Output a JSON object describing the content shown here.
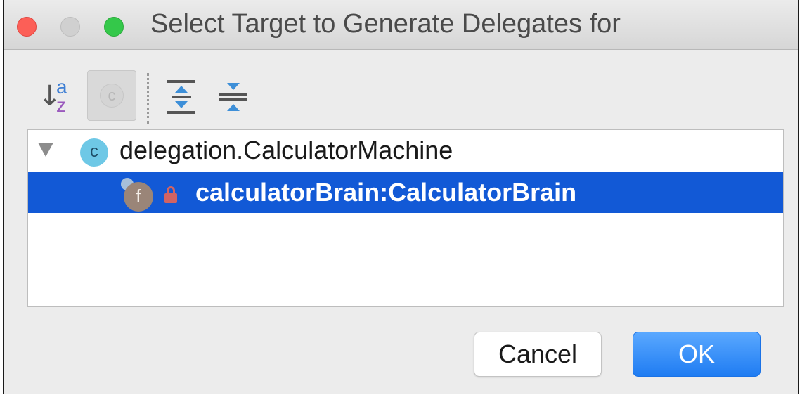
{
  "window": {
    "title": "Select Target to Generate Delegates for"
  },
  "toolbar": {
    "sort_a": "a",
    "sort_z": "z",
    "class_filter_glyph": "c",
    "icons": [
      "sort-alphabetically-icon",
      "class-filter-icon",
      "expand-all-icon",
      "collapse-all-icon"
    ]
  },
  "tree": {
    "class_node": {
      "icon_glyph": "c",
      "label": "delegation.CalculatorMachine",
      "expanded": true
    },
    "field_node": {
      "icon_glyph": "f",
      "label": "calculatorBrain:CalculatorBrain",
      "selected": true
    }
  },
  "buttons": {
    "cancel": "Cancel",
    "ok": "OK"
  },
  "colors": {
    "selection": "#1259d6",
    "ok_button": "#1f7cf2",
    "close": "#fc5f57",
    "maximize": "#34c84a"
  }
}
